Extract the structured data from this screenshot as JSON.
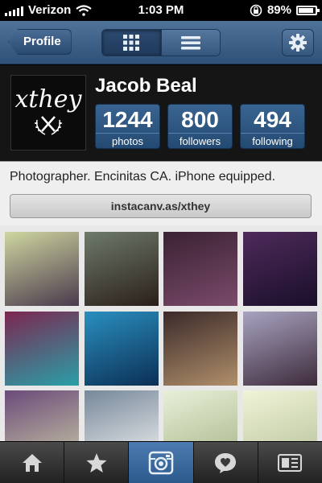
{
  "status": {
    "carrier": "Verizon",
    "time": "1:03 PM",
    "battery": "89%"
  },
  "nav": {
    "back_label": "Profile"
  },
  "profile": {
    "avatar_text": "xthey",
    "name": "Jacob Beal",
    "stats": [
      {
        "value": "1244",
        "label": "photos"
      },
      {
        "value": "800",
        "label": "followers"
      },
      {
        "value": "494",
        "label": "following"
      }
    ],
    "bio": "Photographer. Encinitas CA. iPhone equipped.",
    "website": "instacanv.as/xthey"
  },
  "photos": [
    {
      "desc": "building-sunset",
      "colors": [
        "#cfd6a0",
        "#4a3a4c"
      ]
    },
    {
      "desc": "palm-boardwalk",
      "colors": [
        "#6e7a6b",
        "#2a1f1a"
      ]
    },
    {
      "desc": "night-storefront",
      "colors": [
        "#3a2233",
        "#7a4a6a"
      ]
    },
    {
      "desc": "night-street",
      "colors": [
        "#4e2a5a",
        "#1a0f2a"
      ]
    },
    {
      "desc": "beer-bottle-pool",
      "colors": [
        "#7c2650",
        "#2aa0a8"
      ]
    },
    {
      "desc": "palm-silhouette-blue",
      "colors": [
        "#2a8fbf",
        "#0b2f55"
      ]
    },
    {
      "desc": "phone-in-hand",
      "colors": [
        "#3b2a2a",
        "#b08f6a"
      ]
    },
    {
      "desc": "palm-trees-pink-sky",
      "colors": [
        "#a8a3c0",
        "#3d2b3b"
      ]
    },
    {
      "desc": "stairs-building",
      "colors": [
        "#6b4a7a",
        "#c7c7a5"
      ]
    },
    {
      "desc": "white-car",
      "colors": [
        "#76889a",
        "#f0f0f0"
      ]
    },
    {
      "desc": "pale-sky",
      "colors": [
        "#e7f0d8",
        "#a8b68a"
      ]
    },
    {
      "desc": "faded-sky",
      "colors": [
        "#f0f4d8",
        "#b7c29a"
      ]
    }
  ],
  "tabs": [
    {
      "name": "home-icon",
      "active": false
    },
    {
      "name": "star-icon",
      "active": false
    },
    {
      "name": "camera-icon",
      "active": true
    },
    {
      "name": "activity-icon",
      "active": false
    },
    {
      "name": "profile-icon",
      "active": false
    }
  ]
}
